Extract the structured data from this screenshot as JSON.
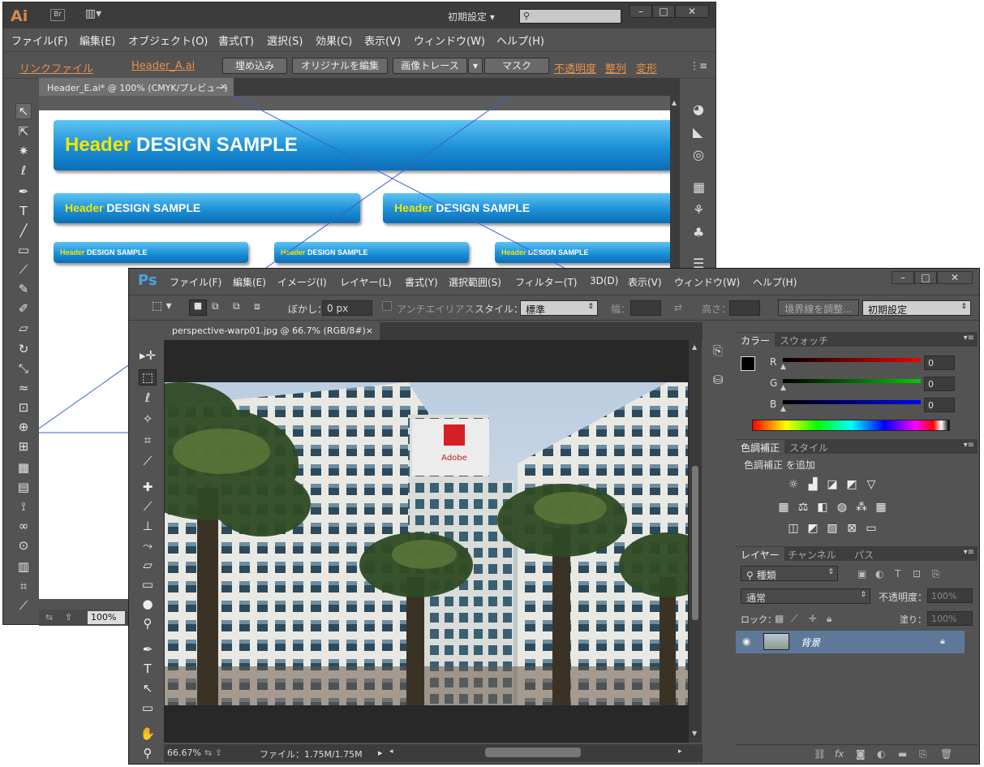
{
  "illustrator": {
    "logo": "Ai",
    "br_label": "Br",
    "workspace": "初期設定",
    "menu": [
      "ファイル(F)",
      "編集(E)",
      "オブジェクト(O)",
      "書式(T)",
      "選択(S)",
      "効果(C)",
      "表示(V)",
      "ウィンドウ(W)",
      "ヘルプ(H)"
    ],
    "control": {
      "link_file": "リンクファイル",
      "file_name": "Header_A.ai",
      "embed": "埋め込み",
      "edit_original": "オリジナルを編集",
      "image_trace": "画像トレース",
      "mask": "マスク",
      "opacity": "不透明度",
      "align": "整列",
      "transform": "変形"
    },
    "tab": "Header_E.ai* @ 100% (CMYK/プレビュー)",
    "zoom": "100%",
    "headers": {
      "yellow": "Header",
      "white": "DESIGN SAMPLE"
    }
  },
  "photoshop": {
    "logo": "Ps",
    "menu": [
      "ファイル(F)",
      "編集(E)",
      "イメージ(I)",
      "レイヤー(L)",
      "書式(Y)",
      "選択範囲(S)",
      "フィルター(T)",
      "3D(D)",
      "表示(V)",
      "ウィンドウ(W)",
      "ヘルプ(H)"
    ],
    "options": {
      "feather_label": "ぼかし：",
      "feather_value": "0 px",
      "antialias": "アンチエイリアス",
      "style_label": "スタイル：",
      "style_value": "標準",
      "width_label": "幅：",
      "height_label": "高さ：",
      "refine_edge": "境界線を調整...",
      "workspace": "初期設定"
    },
    "tab": "perspective-warp01.jpg @ 66.7% (RGB/8#)",
    "status": {
      "zoom": "66.67%",
      "file": "ファイル：1.75M/1.75M"
    },
    "color_panel": {
      "tabs": [
        "カラー",
        "スウォッチ"
      ],
      "r_label": "R",
      "g_label": "G",
      "b_label": "B",
      "r": "0",
      "g": "0",
      "b": "0"
    },
    "adjust_panel": {
      "tabs": [
        "色調補正",
        "スタイル"
      ],
      "title": "色調補正 を追加"
    },
    "layers_panel": {
      "tabs": [
        "レイヤー",
        "チャンネル",
        "パス"
      ],
      "filter": "種類",
      "blend": "通常",
      "opacity_label": "不透明度：",
      "opacity": "100%",
      "lock_label": "ロック：",
      "fill_label": "塗り：",
      "fill": "100%",
      "layer_name": "背景"
    },
    "photo_sign": "Adobe"
  }
}
